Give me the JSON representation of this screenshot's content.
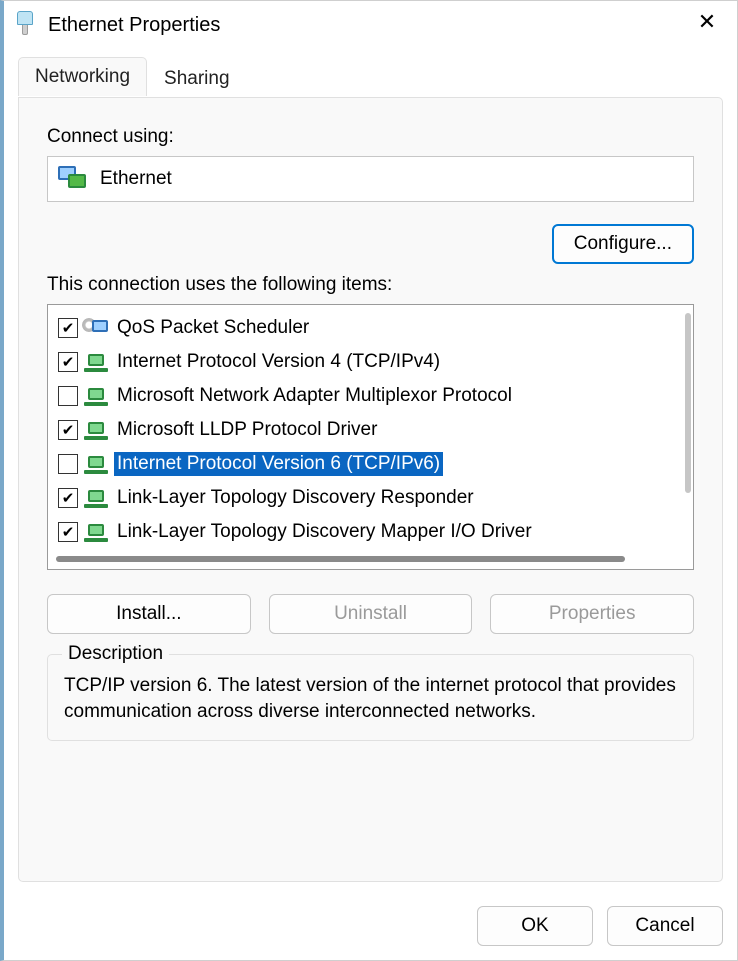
{
  "window": {
    "title": "Ethernet Properties"
  },
  "tabs": {
    "networking": "Networking",
    "sharing": "Sharing"
  },
  "connect_using": {
    "label": "Connect using:",
    "adapter": "Ethernet"
  },
  "buttons": {
    "configure": "Configure...",
    "install": "Install...",
    "uninstall": "Uninstall",
    "properties": "Properties",
    "ok": "OK",
    "cancel": "Cancel"
  },
  "items_label": "This connection uses the following items:",
  "items": [
    {
      "label": "QoS Packet Scheduler",
      "checked": true,
      "iconType": "qos",
      "selected": false
    },
    {
      "label": "Internet Protocol Version 4 (TCP/IPv4)",
      "checked": true,
      "iconType": "proto",
      "selected": false
    },
    {
      "label": "Microsoft Network Adapter Multiplexor Protocol",
      "checked": false,
      "iconType": "proto",
      "selected": false
    },
    {
      "label": "Microsoft LLDP Protocol Driver",
      "checked": true,
      "iconType": "proto",
      "selected": false
    },
    {
      "label": "Internet Protocol Version 6 (TCP/IPv6)",
      "checked": false,
      "iconType": "proto",
      "selected": true
    },
    {
      "label": "Link-Layer Topology Discovery Responder",
      "checked": true,
      "iconType": "proto",
      "selected": false
    },
    {
      "label": "Link-Layer Topology Discovery Mapper I/O Driver",
      "checked": true,
      "iconType": "proto",
      "selected": false
    }
  ],
  "description": {
    "legend": "Description",
    "text": "TCP/IP version 6. The latest version of the internet protocol that provides communication across diverse interconnected networks."
  }
}
